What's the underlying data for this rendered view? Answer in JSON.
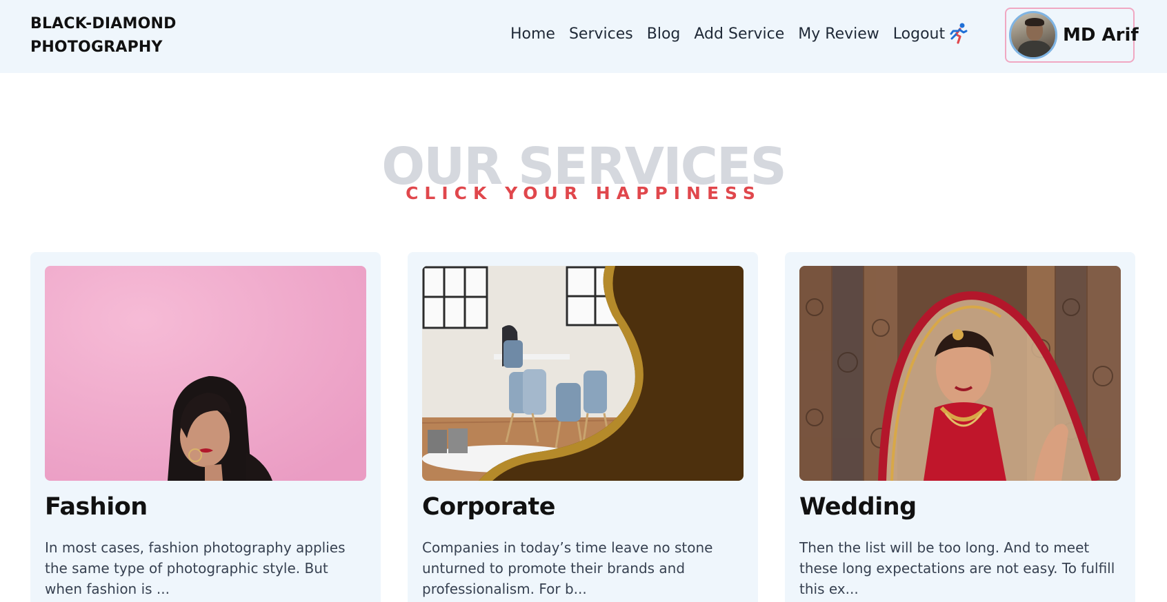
{
  "brand": {
    "line1": "BLACK-DIAMOND",
    "line2": "PHOTOGRAPHY"
  },
  "nav": {
    "items": [
      {
        "label": "Home"
      },
      {
        "label": "Services"
      },
      {
        "label": "Blog"
      },
      {
        "label": "Add Service"
      },
      {
        "label": "My Review"
      }
    ],
    "logout_label": "Logout",
    "logout_icon": "running-person-icon"
  },
  "profile": {
    "name": "MD Arif",
    "avatar": "user-avatar"
  },
  "section": {
    "title": "OUR SERVICES",
    "subtitle": "CLICK YOUR HAPPINESS"
  },
  "services": [
    {
      "title": "Fashion",
      "description": "In most cases, fashion photography applies the same type of photographic style. But when fashion is ...",
      "image": "fashion-photo"
    },
    {
      "title": "Corporate",
      "description": "Companies in today’s time leave no stone unturned to promote their brands and professionalism. For b...",
      "image": "corporate-photo"
    },
    {
      "title": "Wedding",
      "description": "Then the list will be too long. And to meet these long expectations are not easy. To fulfill this ex...",
      "image": "wedding-photo"
    }
  ],
  "colors": {
    "nav_bg": "#eff6fc",
    "accent": "#e0474c",
    "title_gray": "#d5d8de",
    "profile_border": "#f0a7c2"
  }
}
